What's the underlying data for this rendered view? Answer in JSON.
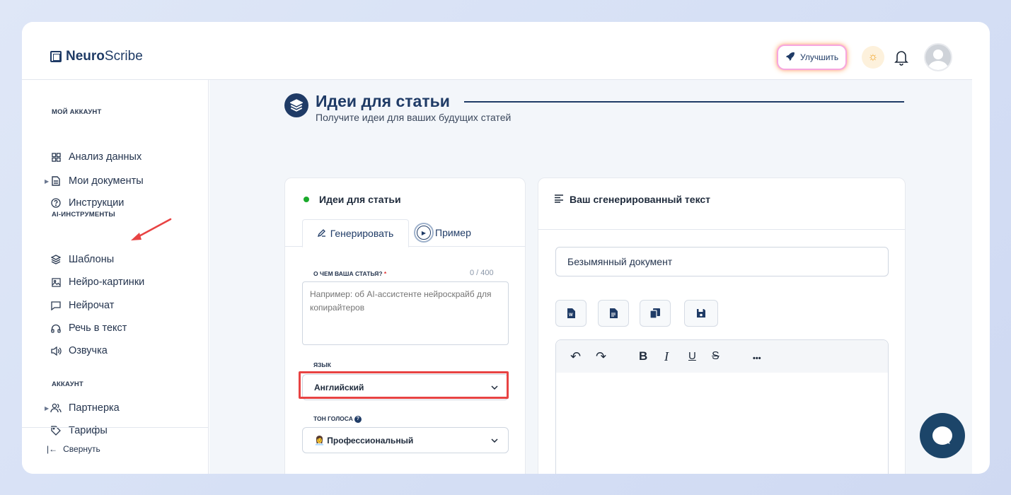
{
  "brand": {
    "bold": "Neuro",
    "regular": "Scribe"
  },
  "header": {
    "upgrade_label": "Улучшить"
  },
  "sidebar": {
    "sections": [
      {
        "title": "МОЙ АККАУНТ"
      },
      {
        "title": "AI-ИНСТРУМЕНТЫ"
      },
      {
        "title": "АККАУНТ"
      }
    ],
    "items": [
      {
        "label": "Анализ данных",
        "icon": "grid-icon"
      },
      {
        "label": "Мои документы",
        "icon": "document-icon"
      },
      {
        "label": "Инструкции",
        "icon": "help-circle-icon"
      },
      {
        "label": "Шаблоны",
        "icon": "layers-icon"
      },
      {
        "label": "Нейро-картинки",
        "icon": "image-icon"
      },
      {
        "label": "Нейрочат",
        "icon": "chat-icon"
      },
      {
        "label": "Речь в текст",
        "icon": "headphones-icon"
      },
      {
        "label": "Озвучка",
        "icon": "speaker-icon"
      },
      {
        "label": "Партнерка",
        "icon": "users-icon"
      },
      {
        "label": "Тарифы",
        "icon": "tag-icon"
      }
    ],
    "collapse_label": "Свернуть"
  },
  "page": {
    "title": "Идеи для статьи",
    "subtitle": "Получите идеи для ваших будущих статей"
  },
  "left_card": {
    "title": "Идеи для статьи",
    "tab_generate": "Генерировать",
    "tab_example": "Пример",
    "topic_label": "О ЧЕМ ВАША СТАТЬЯ?",
    "topic_required": "*",
    "topic_counter": "0 / 400",
    "topic_placeholder": "Например: об AI-ассистенте нейроскрайб для копирайтеров",
    "topic_value": "",
    "language_label": "ЯЗЫК",
    "language_value": "Английский",
    "tone_label": "ТОН ГОЛОСА",
    "tone_emoji": "👩‍💼",
    "tone_value": "Профессиональный"
  },
  "right_card": {
    "title": "Ваш сгенерированный текст",
    "document_name": "Безымянный документ",
    "toolbar_buttons": [
      "word-file-icon",
      "text-file-icon",
      "copy-icon",
      "save-icon"
    ],
    "editor_tools": {
      "undo": "↶",
      "redo": "↷",
      "bold": "B",
      "italic": "I",
      "underline": "U",
      "strike": "S",
      "more": "•••"
    }
  },
  "colors": {
    "primary": "#1f3b66",
    "highlight": "#e84343",
    "status_green": "#1aaa2b",
    "chat_fab": "#1c4569"
  }
}
